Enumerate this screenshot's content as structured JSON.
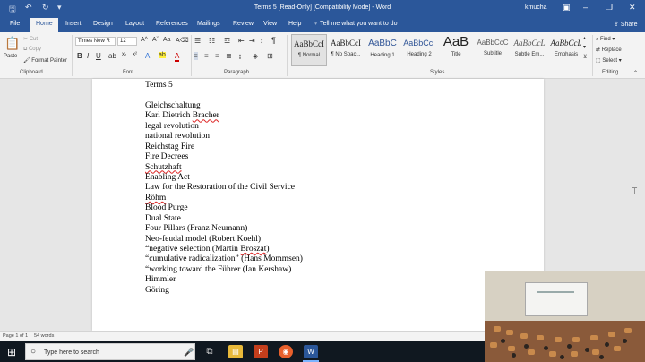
{
  "window": {
    "title": "Terms 5 [Read-Only] [Compatibility Mode] - Word",
    "user": "kmucha",
    "controls": [
      "–",
      "❐",
      "✕"
    ]
  },
  "quick_access": {
    "save_icon": "save-icon",
    "undo_icon": "undo-icon",
    "redo_icon": "redo-icon",
    "more_icon": "customize-icon"
  },
  "ribbon_tabs": [
    "File",
    "Home",
    "Insert",
    "Design",
    "Layout",
    "References",
    "Mailings",
    "Review",
    "View",
    "Help"
  ],
  "tell_me": "Tell me what you want to do",
  "share": "Share",
  "clipboard": {
    "paste": "Paste",
    "cut": "Cut",
    "copy": "Copy",
    "format_painter": "Format Painter",
    "label": "Clipboard"
  },
  "font": {
    "name": "Times New R",
    "size": "12",
    "label": "Font"
  },
  "paragraph": {
    "label": "Paragraph"
  },
  "styles": {
    "label": "Styles",
    "items": [
      {
        "sample": "AaBbCcI",
        "name": "¶ Normal"
      },
      {
        "sample": "AaBbCcI",
        "name": "¶ No Spac..."
      },
      {
        "sample": "AaBbC",
        "name": "Heading 1"
      },
      {
        "sample": "AaBbCcI",
        "name": "Heading 2"
      },
      {
        "sample": "AaB",
        "name": "Title"
      },
      {
        "sample": "AaBbCcC",
        "name": "Subtitle"
      },
      {
        "sample": "AaBbCcL",
        "name": "Subtle Em..."
      },
      {
        "sample": "AaBbCcL",
        "name": "Emphasis"
      }
    ]
  },
  "editing": {
    "find": "Find",
    "replace": "Replace",
    "select": "Select",
    "label": "Editing"
  },
  "document": {
    "lines": [
      "Terms 5",
      "",
      "Gleichschaltung",
      "Karl Dietrich Bracher",
      "legal revolution",
      "national revolution",
      "Reichstag Fire",
      "Fire Decrees",
      "Schutzhaft",
      "Enabling Act",
      "Law for the Restoration of the Civil Service",
      "Röhm",
      "Blood Purge",
      "Dual State",
      "Four Pillars (Franz Neumann)",
      "Neo-feudal model (Robert Koehl)",
      "“negative selection (Martin Broszat)",
      "“cumulative radicalization” (Hans Mommsen)",
      "“working toward the Führer (Ian Kershaw)",
      "Himmler",
      "Göring"
    ]
  },
  "status": {
    "page": "Page 1 of 1",
    "words": "54 words"
  },
  "taskbar": {
    "search_placeholder": "Type here to search"
  }
}
